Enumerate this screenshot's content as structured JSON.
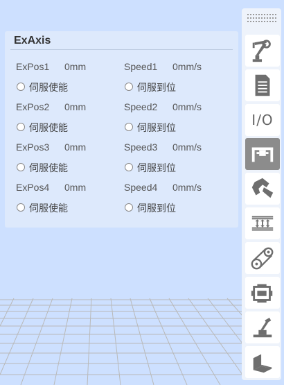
{
  "panel": {
    "title": "ExAxis",
    "rows": [
      {
        "pos_label": "ExPos1",
        "pos_value": "0mm",
        "speed_label": "Speed1",
        "speed_value": "0mm/s",
        "servo_enable": "伺服使能",
        "servo_ready": "伺服到位"
      },
      {
        "pos_label": "ExPos2",
        "pos_value": "0mm",
        "speed_label": "Speed2",
        "speed_value": "0mm/s",
        "servo_enable": "伺服使能",
        "servo_ready": "伺服到位"
      },
      {
        "pos_label": "ExPos3",
        "pos_value": "0mm",
        "speed_label": "Speed3",
        "speed_value": "0mm/s",
        "servo_enable": "伺服使能",
        "servo_ready": "伺服到位"
      },
      {
        "pos_label": "ExPos4",
        "pos_value": "0mm",
        "speed_label": "Speed4",
        "speed_value": "0mm/s",
        "servo_enable": "伺服使能",
        "servo_ready": "伺服到位"
      }
    ]
  },
  "toolbar": {
    "io_label": "I/O",
    "items": [
      {
        "icon": "robot-arm-icon",
        "active": false
      },
      {
        "icon": "document-icon",
        "active": false
      },
      {
        "icon": "io-icon",
        "active": false
      },
      {
        "icon": "external-axis-icon",
        "active": true
      },
      {
        "icon": "gripper-icon",
        "active": false
      },
      {
        "icon": "conveyor-icon",
        "active": false
      },
      {
        "icon": "belt-drive-icon",
        "active": false
      },
      {
        "icon": "motor-icon",
        "active": false
      },
      {
        "icon": "joystick-icon",
        "active": false
      },
      {
        "icon": "workpiece-icon",
        "active": false
      }
    ]
  },
  "colors": {
    "background": "#cde0ff",
    "panel": "#dde9fc",
    "active_tool": "#8c8c8c",
    "icon": "#6e6e6e"
  }
}
